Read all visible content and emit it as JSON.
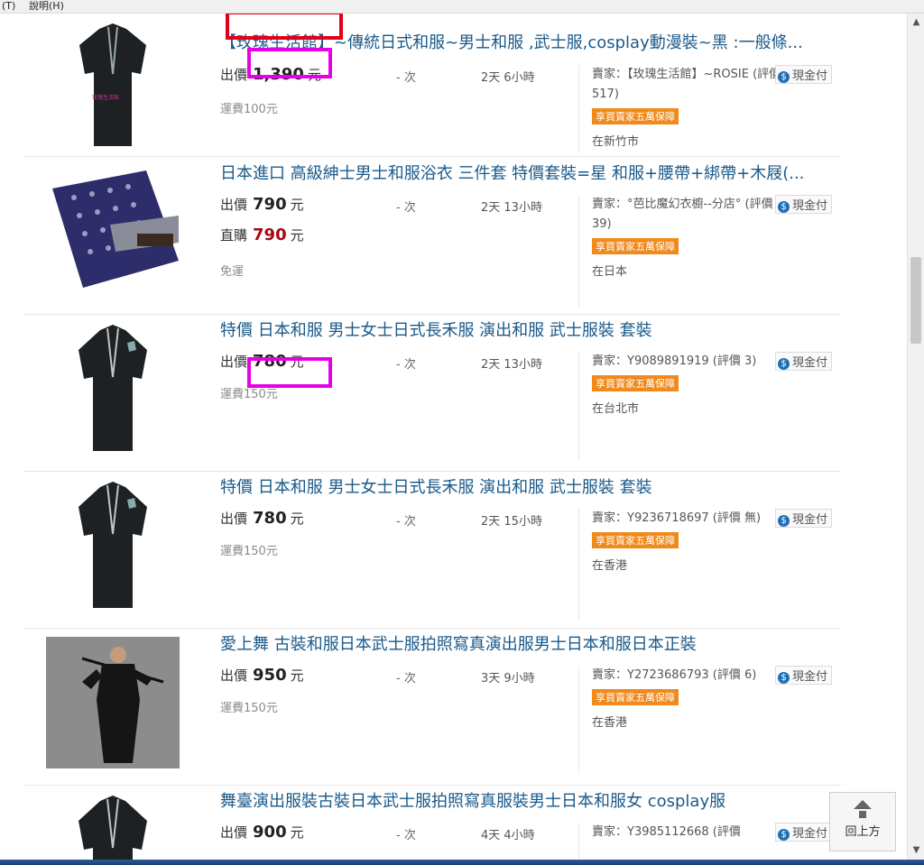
{
  "menubar": {
    "item_tools": "(T)",
    "item_help": "說明(H)"
  },
  "listings": [
    {
      "title": "【玫瑰生活館】~傳統日式和服~男士和服 ,武士服,cosplay動漫裝~黑 :一般條...",
      "price_label": "出價",
      "price": "1,390",
      "unit": "元",
      "direct_label": "",
      "direct_price": "",
      "shipping": "運費100元",
      "bids": "- 次",
      "time_left": "2天 6小時",
      "seller": "賣家：【玫瑰生活館】~ROSIE (評價 517)",
      "badge": "享買賣家五萬保障",
      "location": "在新竹市",
      "payment": "現金付"
    },
    {
      "title": "日本進口 高級紳士男士和服浴衣 三件套 特價套裝=星 和服+腰帶+綁帶+木屐(...",
      "price_label": "出價",
      "price": "790",
      "unit": "元",
      "direct_label": "直購",
      "direct_price": "790",
      "shipping": "免運",
      "bids": "- 次",
      "time_left": "2天 13小時",
      "seller": "賣家：°芭比魔幻衣櫥--分店° (評價 39)",
      "badge": "享買賣家五萬保障",
      "location": "在日本",
      "payment": "現金付"
    },
    {
      "title": "特價 日本和服 男士女士日式長禾服 演出和服 武士服裝 套裝",
      "price_label": "出價",
      "price": "780",
      "unit": "元",
      "direct_label": "",
      "direct_price": "",
      "shipping": "運費150元",
      "bids": "- 次",
      "time_left": "2天 13小時",
      "seller": "賣家：Y9089891919 (評價 3)",
      "badge": "享買賣家五萬保障",
      "location": "在台北市",
      "payment": "現金付"
    },
    {
      "title": "特價 日本和服 男士女士日式長禾服 演出和服 武士服裝 套裝",
      "price_label": "出價",
      "price": "780",
      "unit": "元",
      "direct_label": "",
      "direct_price": "",
      "shipping": "運費150元",
      "bids": "- 次",
      "time_left": "2天 15小時",
      "seller": "賣家：Y9236718697 (評價 無)",
      "badge": "享買賣家五萬保障",
      "location": "在香港",
      "payment": "現金付"
    },
    {
      "title": "愛上舞 古裝和服日本武士服拍照寫真演出服男士日本和服日本正裝",
      "price_label": "出價",
      "price": "950",
      "unit": "元",
      "direct_label": "",
      "direct_price": "",
      "shipping": "運費150元",
      "bids": "- 次",
      "time_left": "3天 9小時",
      "seller": "賣家：Y2723686793 (評價 6)",
      "badge": "享買賣家五萬保障",
      "location": "在香港",
      "payment": "現金付"
    },
    {
      "title": "舞臺演出服裝古裝日本武士服拍照寫真服裝男士日本和服女 cosplay服",
      "price_label": "出價",
      "price": "900",
      "unit": "元",
      "direct_label": "",
      "direct_price": "",
      "shipping": "",
      "bids": "- 次",
      "time_left": "4天 4小時",
      "seller": "賣家：Y3985112668 (評價",
      "badge": "",
      "location": "",
      "payment": "現金付"
    }
  ],
  "back_to_top": {
    "label": "回上方"
  },
  "scrollbar": {
    "up": "▲",
    "down": "▼"
  }
}
